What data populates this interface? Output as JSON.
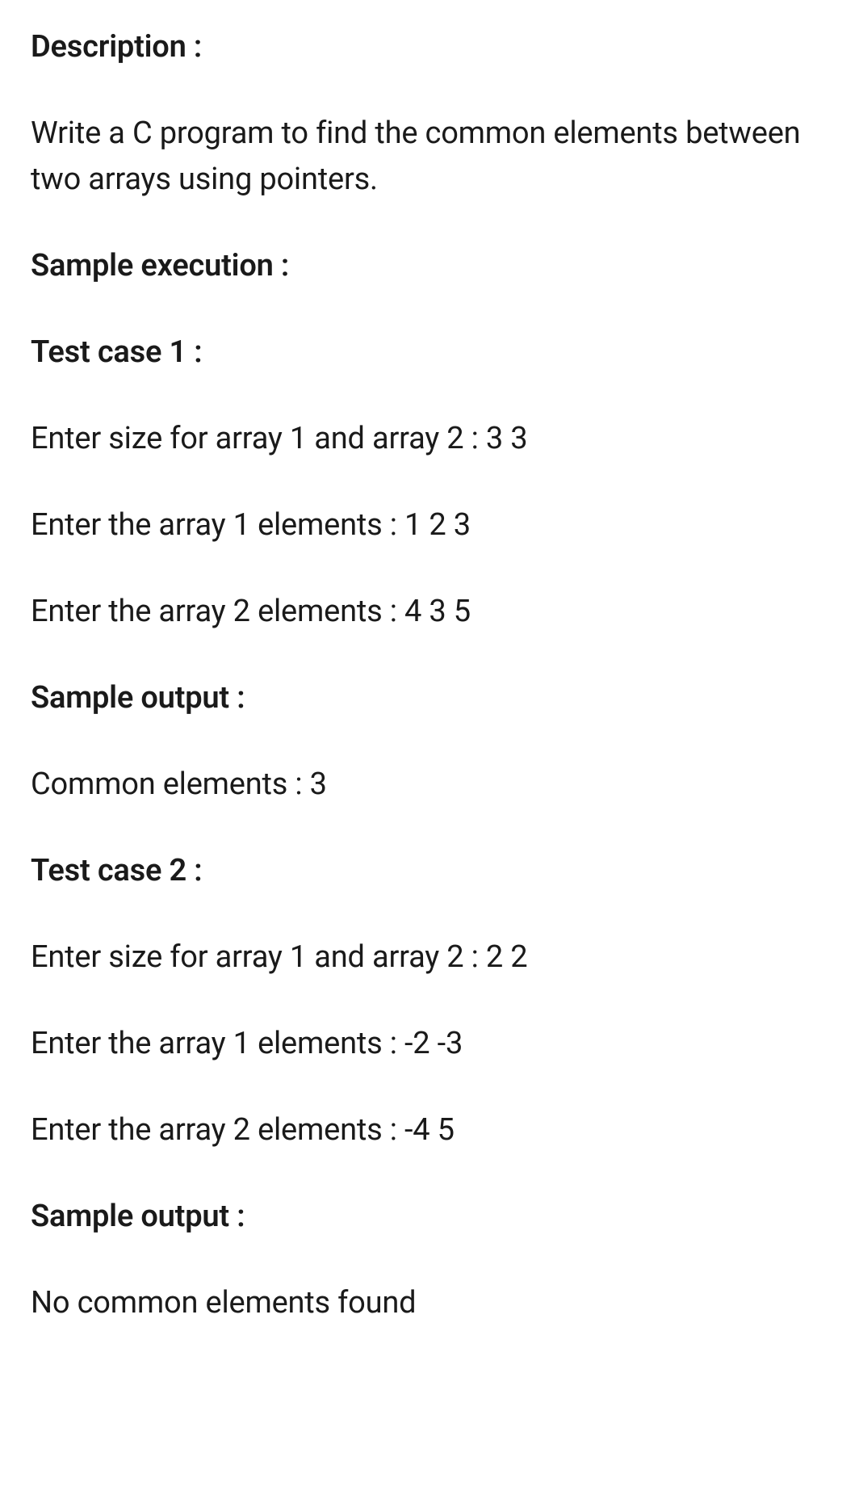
{
  "description_heading": "Description :",
  "description_body": "Write a C program to find the common elements between two arrays using pointers.",
  "sample_execution_heading": "Sample execution :",
  "testcase1": {
    "heading": "Test case 1 :",
    "size_line": "Enter size for array 1 and array 2 : 3 3",
    "arr1_line": "Enter the array 1 elements : 1 2 3",
    "arr2_line": "Enter the array 2 elements : 4 3 5",
    "output_heading": "Sample output :",
    "output_body": "Common elements : 3"
  },
  "testcase2": {
    "heading": "Test case 2 :",
    "size_line": "Enter size for array 1 and array 2 : 2 2",
    "arr1_line": "Enter the array 1 elements : -2 -3",
    "arr2_line": "Enter the array 2 elements : -4 5",
    "output_heading": "Sample output :",
    "output_body": "No common elements found"
  }
}
